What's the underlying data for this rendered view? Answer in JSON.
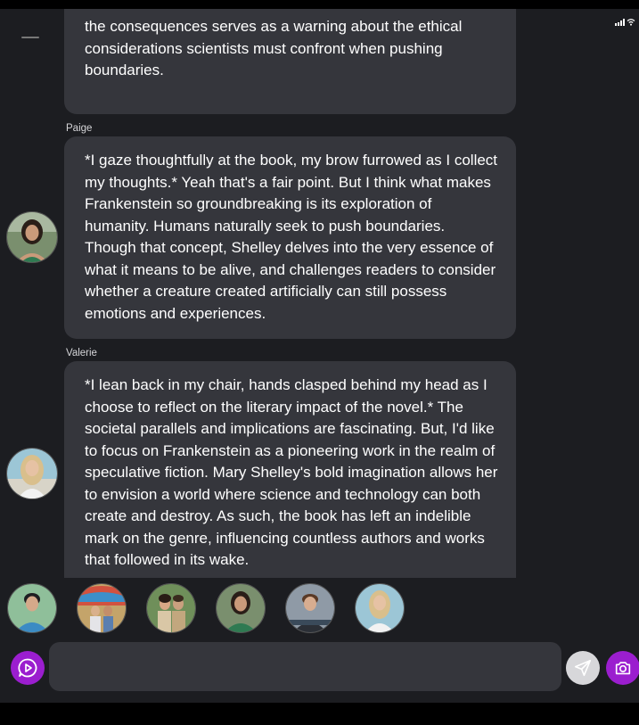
{
  "messages": [
    {
      "text": "the consequences serves as a warning about the ethical considerations scientists must confront when pushing boundaries."
    },
    {
      "sender": "Paige",
      "text": "*I gaze thoughtfully at the book, my brow furrowed as I collect my thoughts.* Yeah that's a fair point. But I think what makes Frankenstein so groundbreaking is its exploration of humanity. Humans naturally seek to push boundaries. Though that concept, Shelley delves into the very essence of what it means to be alive, and challenges readers to consider whether a creature created artificially can still possess emotions and experiences."
    },
    {
      "sender": "Valerie",
      "text": "*I lean back in my chair, hands clasped behind my head as I choose to reflect on the literary impact of the novel.* The societal parallels and implications are fascinating. But, I'd like to focus on Frankenstein as a pioneering work in the realm of speculative fiction. Mary Shelley's bold imagination allows her to envision a world where science and technology can both create and destroy. As such, the book has left an indelible mark on the genre, influencing countless authors and works that followed in its wake."
    }
  ],
  "input": {
    "value": "",
    "placeholder": ""
  },
  "icons": {
    "play": "play-message-icon",
    "send": "send-icon",
    "camera": "camera-icon",
    "signal": "signal-icon",
    "wifi": "wifi-icon"
  },
  "colors": {
    "accent": "#9b1ecf",
    "bubble": "#35363c",
    "background": "#1c1d21"
  }
}
